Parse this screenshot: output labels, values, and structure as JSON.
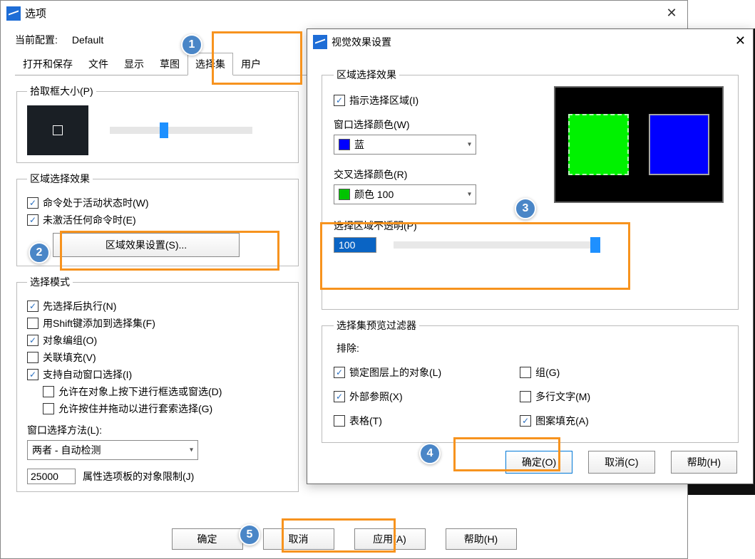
{
  "main": {
    "title": "选项",
    "config_label": "当前配置:",
    "config_value": "Default",
    "tabs": [
      "打开和保存",
      "文件",
      "显示",
      "草图",
      "选择集",
      "用户"
    ],
    "active_tab_index": 4,
    "pickbox": {
      "legend": "拾取框大小(P)"
    },
    "area_effect": {
      "legend": "区域选择效果",
      "chk_active": "命令处于活动状态时(W)",
      "chk_inactive": "未激活任何命令时(E)",
      "btn_settings": "区域效果设置(S)..."
    },
    "select_mode": {
      "legend": "选择模式",
      "chk_pre": "先选择后执行(N)",
      "chk_shift": "用Shift键添加到选择集(F)",
      "chk_group": "对象编组(O)",
      "chk_hatch": "关联填充(V)",
      "chk_window": "支持自动窗口选择(I)",
      "chk_press": "允许在对象上按下进行框选或窗选(D)",
      "chk_lasso": "允许按住并拖动以进行套索选择(G)",
      "method_label": "窗口选择方法(L):",
      "method_value": "两者 - 自动检测",
      "limit_value": "25000",
      "limit_label": "属性选项板的对象限制(J)"
    },
    "buttons": {
      "ok": "确定",
      "cancel": "取消",
      "apply": "应用(A)",
      "help": "帮助(H)"
    }
  },
  "popup": {
    "title": "视觉效果设置",
    "section1": "区域选择效果",
    "chk_indicate": "指示选择区域(I)",
    "window_color_label": "窗口选择颜色(W)",
    "window_color_value": "蓝",
    "cross_color_label": "交叉选择颜色(R)",
    "cross_color_value": "颜色 100",
    "opacity_label": "选择区域不透明(P)",
    "opacity_value": "100",
    "filter_header": "选择集预览过滤器",
    "filter_exclude": "排除:",
    "chk_locked": "锁定图层上的对象(L)",
    "chk_xref": "外部参照(X)",
    "chk_table": "表格(T)",
    "chk_group": "组(G)",
    "chk_mtext": "多行文字(M)",
    "chk_pattern": "图案填充(A)",
    "btn_ok": "确定(O)",
    "btn_cancel": "取消(C)",
    "btn_help": "帮助(H)"
  },
  "callouts": {
    "c1": "1",
    "c2": "2",
    "c3": "3",
    "c4": "4",
    "c5": "5"
  }
}
